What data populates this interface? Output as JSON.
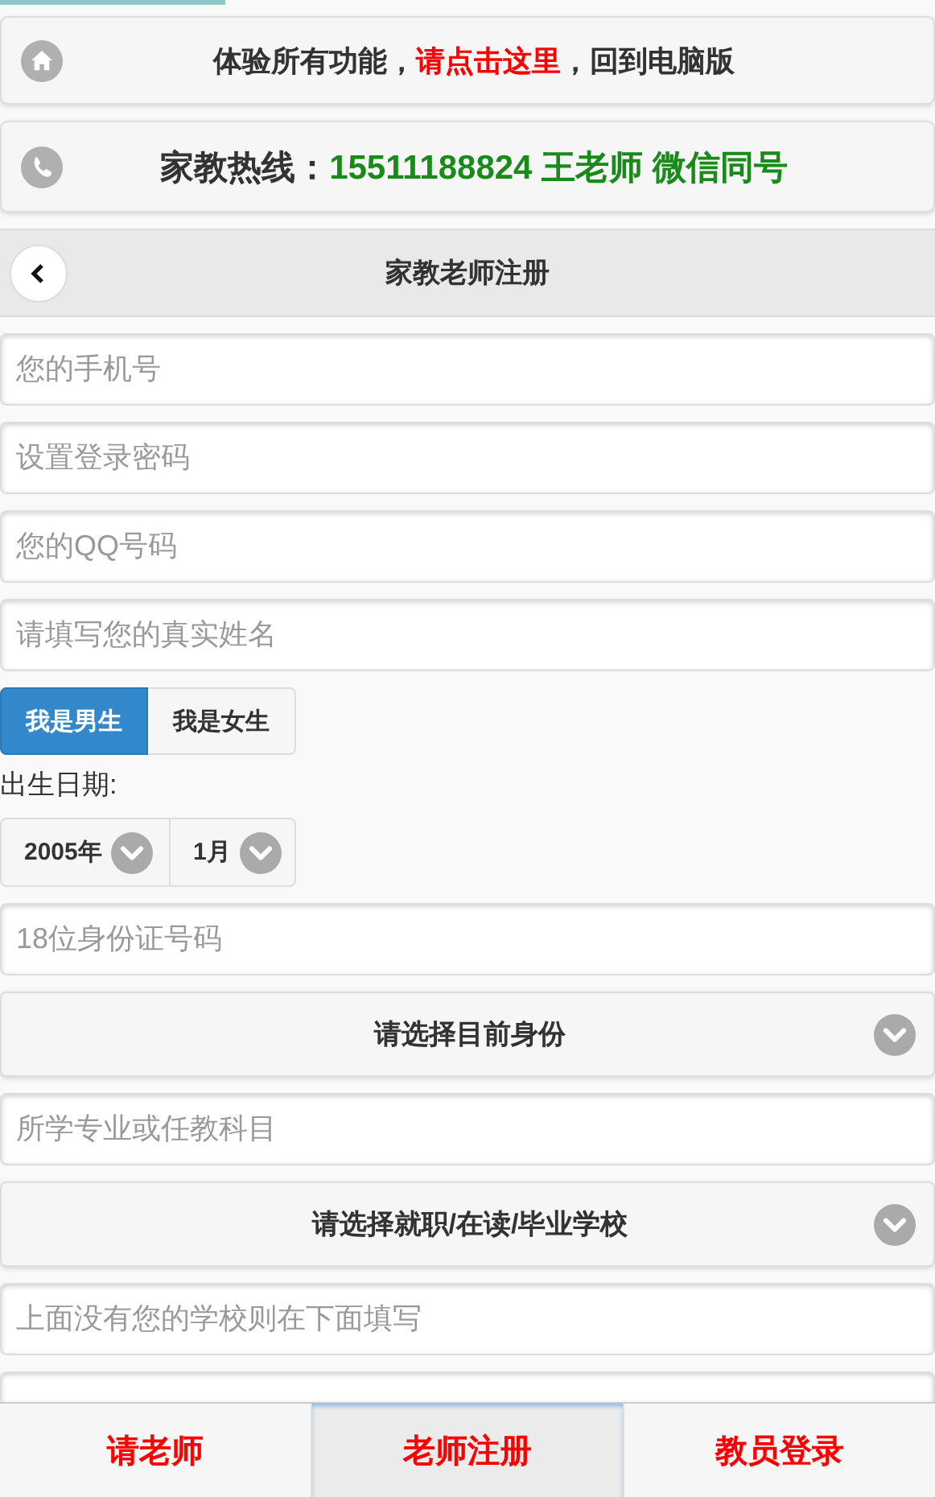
{
  "notice": {
    "parts": [
      {
        "kind": "text",
        "text": "体验所有功能，"
      },
      {
        "kind": "link",
        "text": "请点击这里"
      },
      {
        "kind": "text",
        "text": "，回到电脑版"
      }
    ]
  },
  "hotline": {
    "label": "家教热线：",
    "value": "15511188824 王老师 微信同号"
  },
  "header": {
    "title": "家教老师注册"
  },
  "form": [
    {
      "kind": "input",
      "placeholder": "您的手机号"
    },
    {
      "kind": "input",
      "placeholder": "设置登录密码"
    },
    {
      "kind": "input",
      "placeholder": "您的QQ号码"
    },
    {
      "kind": "input",
      "placeholder": "请填写您的真实姓名"
    },
    {
      "kind": "segmented",
      "options": [
        {
          "label": "我是男生",
          "selected": true
        },
        {
          "label": "我是女生",
          "selected": false
        }
      ]
    },
    {
      "kind": "label",
      "text": "出生日期:"
    },
    {
      "kind": "dates",
      "selects": [
        {
          "value": "2005年"
        },
        {
          "value": "1月"
        }
      ]
    },
    {
      "kind": "input",
      "placeholder": "18位身份证号码"
    },
    {
      "kind": "select",
      "value": "请选择目前身份"
    },
    {
      "kind": "input",
      "placeholder": "所学专业或任教科目"
    },
    {
      "kind": "select",
      "value": "请选择就职/在读/毕业学校"
    },
    {
      "kind": "input",
      "placeholder": "上面没有您的学校则在下面填写"
    },
    {
      "kind": "input"
    }
  ],
  "bottom_nav": [
    {
      "label": "请老师",
      "selected": false
    },
    {
      "label": "老师注册",
      "selected": true
    },
    {
      "label": "教员登录",
      "selected": false
    }
  ]
}
